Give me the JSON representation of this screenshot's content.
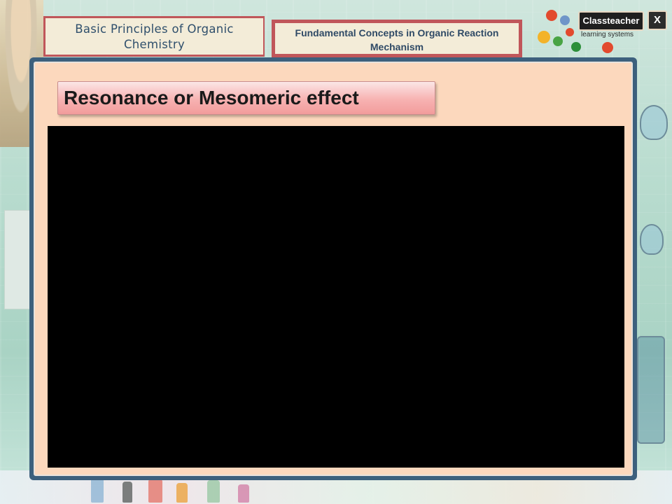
{
  "header": {
    "chapter_title": "Basic Principles of Organic Chemistry",
    "topic_title": "Fundamental Concepts in Organic Reaction Mechanism"
  },
  "brand": {
    "logo_text": "Classteacher",
    "tagline": "learning systems",
    "close_label": "X"
  },
  "content": {
    "section_heading": "Resonance or Mesomeric effect"
  },
  "colors": {
    "panel_border": "#3d607d",
    "panel_fill": "#fcd8bd",
    "tab_border": "#c0565a",
    "heading_fill": "#f7b2b1",
    "video_fill": "#000000"
  }
}
